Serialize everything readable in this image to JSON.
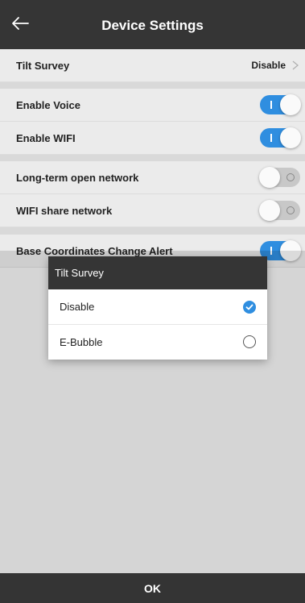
{
  "header": {
    "title": "Device Settings",
    "back_icon": "arrow-left-icon"
  },
  "settings": {
    "tilt_survey": {
      "label": "Tilt Survey",
      "value": "Disable"
    },
    "enable_voice": {
      "label": "Enable Voice",
      "state": "on"
    },
    "enable_wifi": {
      "label": "Enable WIFI",
      "state": "on"
    },
    "long_term_open_network": {
      "label": "Long-term open network",
      "state": "off"
    },
    "wifi_share_network": {
      "label": "WIFI share network",
      "state": "off"
    },
    "base_coord_alert": {
      "label": "Base Coordinates Change Alert",
      "state": "on"
    }
  },
  "dialog": {
    "title": "Tilt Survey",
    "options": [
      {
        "label": "Disable",
        "selected": true
      },
      {
        "label": "E-Bubble",
        "selected": false
      }
    ]
  },
  "footer": {
    "ok_label": "OK"
  },
  "colors": {
    "accent": "#2f8ee0",
    "header_bg": "#353535"
  }
}
